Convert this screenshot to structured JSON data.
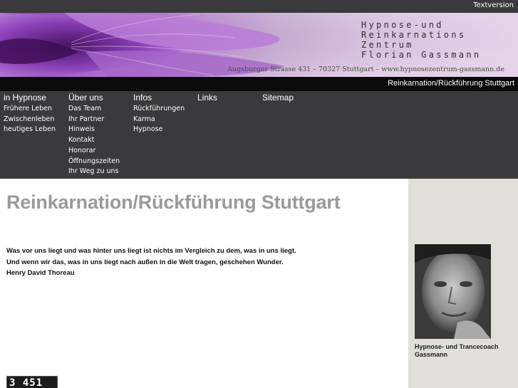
{
  "topbar": {
    "text_version_link": "Textversion"
  },
  "header": {
    "title_lines": [
      "Hypnose-und",
      "Reinkarnations",
      "Zentrum",
      "Florian Gassmann"
    ],
    "address": "Augsburger Strasse 431 – 70327 Stuttgart – www.hypnosezentrum-gassmann.de"
  },
  "strip": {
    "page_label": "Reinkarnation/Rückführung Stuttgart"
  },
  "nav": {
    "columns": [
      {
        "head": "in Hypnose",
        "items": [
          "Frühere Leben",
          "Zwischenleben",
          "heutiges Leben"
        ]
      },
      {
        "head": "Über uns",
        "items": [
          "Das Team",
          "Ihr Partner",
          "Hinweis",
          "Kontakt",
          "Honorar",
          "Öffnungszeiten",
          "Ihr Weg zu uns"
        ]
      },
      {
        "head": "Infos",
        "items": [
          "Rückführungen",
          "Karma",
          "Hypnose"
        ]
      },
      {
        "head": "Links",
        "items": []
      },
      {
        "head": "Sitemap",
        "items": []
      }
    ]
  },
  "main": {
    "title": "Reinkarnation/Rückführung Stuttgart",
    "quote_lines": [
      "Was vor uns liegt und was hinter uns liegt ist nichts im Vergleich zu dem, was in uns liegt.",
      "Und wenn wir das, was in uns liegt nach außen in die Welt tragen, geschehen Wunder.",
      "Henry David Thoreau"
    ],
    "counter": "3 451"
  },
  "sidebar": {
    "caption_lines": [
      "Hypnose- und Trancecoach",
      "Gassmann"
    ]
  }
}
